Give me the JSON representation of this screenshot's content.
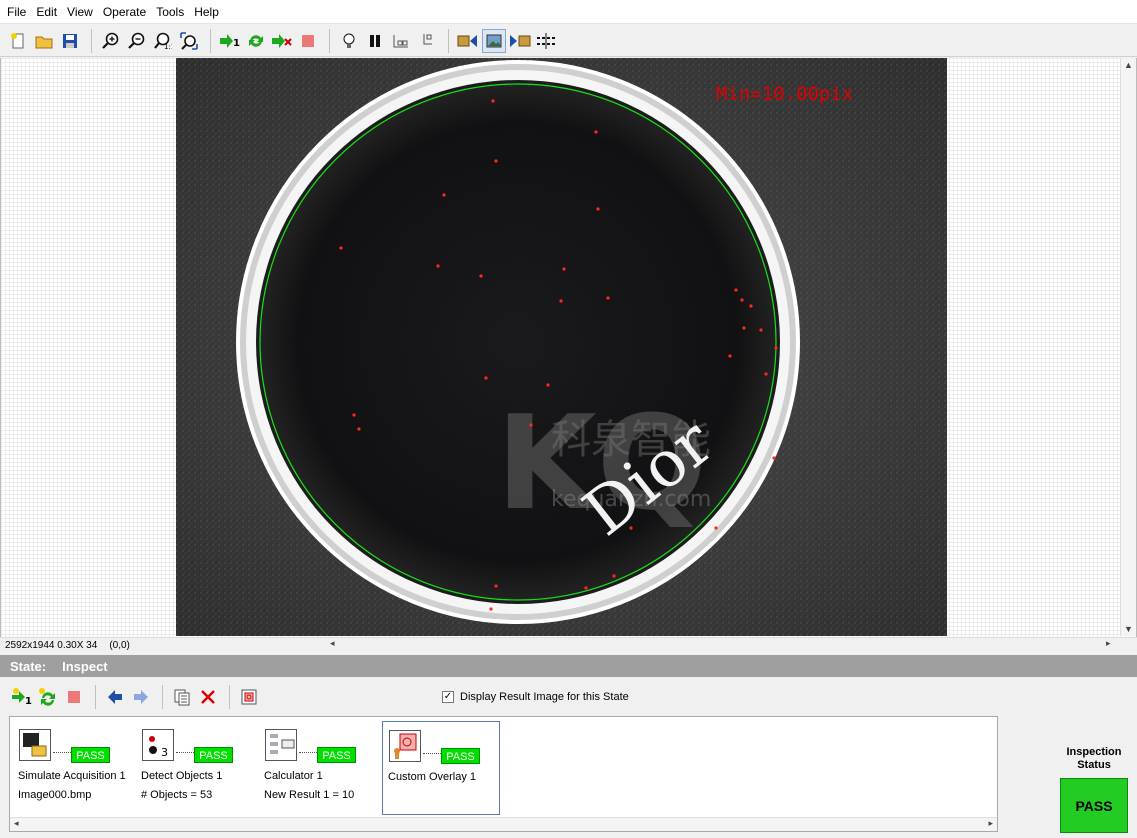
{
  "menu": [
    "File",
    "Edit",
    "View",
    "Operate",
    "Tools",
    "Help"
  ],
  "toolbar": {
    "icons": [
      "new-icon",
      "open-icon",
      "save-icon",
      "zoom-in-icon",
      "zoom-out-icon",
      "zoom-1to1-icon",
      "zoom-fit-icon",
      "run-once-icon",
      "run-continuous-icon",
      "run-inspection-icon",
      "stop-icon",
      "light-icon",
      "pause-icon",
      "step-back-icon",
      "step-icon",
      "image-previous-icon",
      "image-view-icon",
      "image-next-icon",
      "calibration-icon"
    ]
  },
  "image": {
    "overlay_text": "Min=10.00pix",
    "watermark_letters": "KQ",
    "watermark_cn": "科泉智能",
    "watermark_en": "kequanzn.com",
    "brand_text": "Dior",
    "colors": {
      "roi_circle": "#19e019",
      "overlay_text": "#e00000",
      "defect": "#ff2a1a"
    }
  },
  "infobar": {
    "size_zoom": "2592x1944 0.30X 34",
    "coords": "(0,0)"
  },
  "state": {
    "label": "State:",
    "value": "Inspect"
  },
  "state_toolbar": {
    "icons": [
      "add-step-icon",
      "add-state-icon",
      "delete-step-icon",
      "move-left-icon",
      "move-right-icon",
      "copy-icon",
      "remove-icon",
      "settings-icon"
    ]
  },
  "display_result": {
    "checked": true,
    "label": "Display Result Image for this State"
  },
  "steps": [
    {
      "name": "Simulate Acquisition 1",
      "result": "Image000.bmp",
      "status": "PASS"
    },
    {
      "name": "Detect Objects 1",
      "result": "# Objects = 53",
      "status": "PASS"
    },
    {
      "name": "Calculator 1",
      "result": "New Result 1 = 10",
      "status": "PASS"
    },
    {
      "name": "Custom Overlay 1",
      "result": "",
      "status": "PASS"
    }
  ],
  "inspection": {
    "label": "Inspection Status",
    "status": "PASS"
  }
}
